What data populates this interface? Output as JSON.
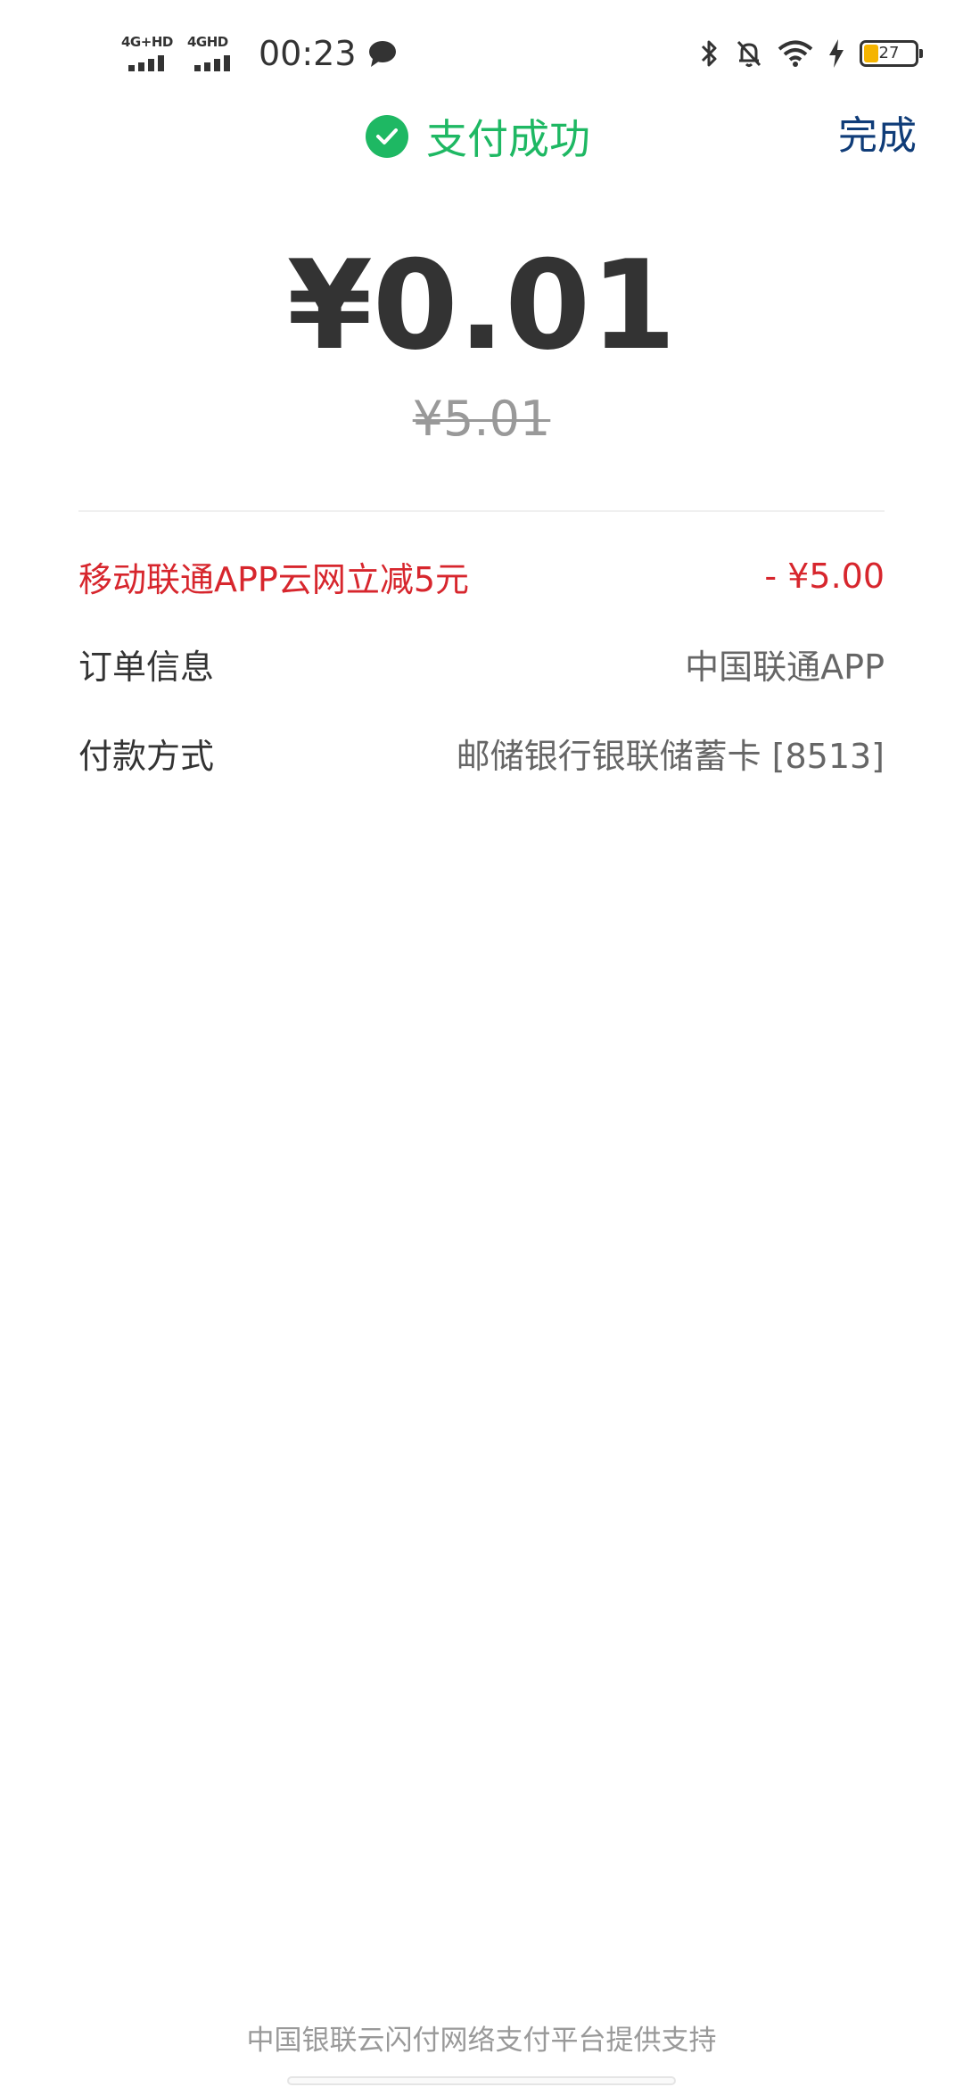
{
  "status_bar": {
    "sim1_label": "4G+HD",
    "sim2_label": "4GHD",
    "time": "00:23",
    "battery_level": "27",
    "battery_color": "#f5b400"
  },
  "header": {
    "title": "支付成功",
    "done_label": "完成",
    "success_color": "#1eb863"
  },
  "payment": {
    "amount": "¥0.01",
    "original_amount": "¥5.01"
  },
  "details": {
    "discount": {
      "label": "移动联通APP云网立减5元",
      "value": "-  ¥5.00"
    },
    "order": {
      "label": "订单信息",
      "value": "中国联通APP"
    },
    "payment_method": {
      "label": "付款方式",
      "value": "邮储银行银联储蓄卡  [8513]"
    }
  },
  "footer": {
    "text": "中国银联云闪付网络支付平台提供支持"
  }
}
